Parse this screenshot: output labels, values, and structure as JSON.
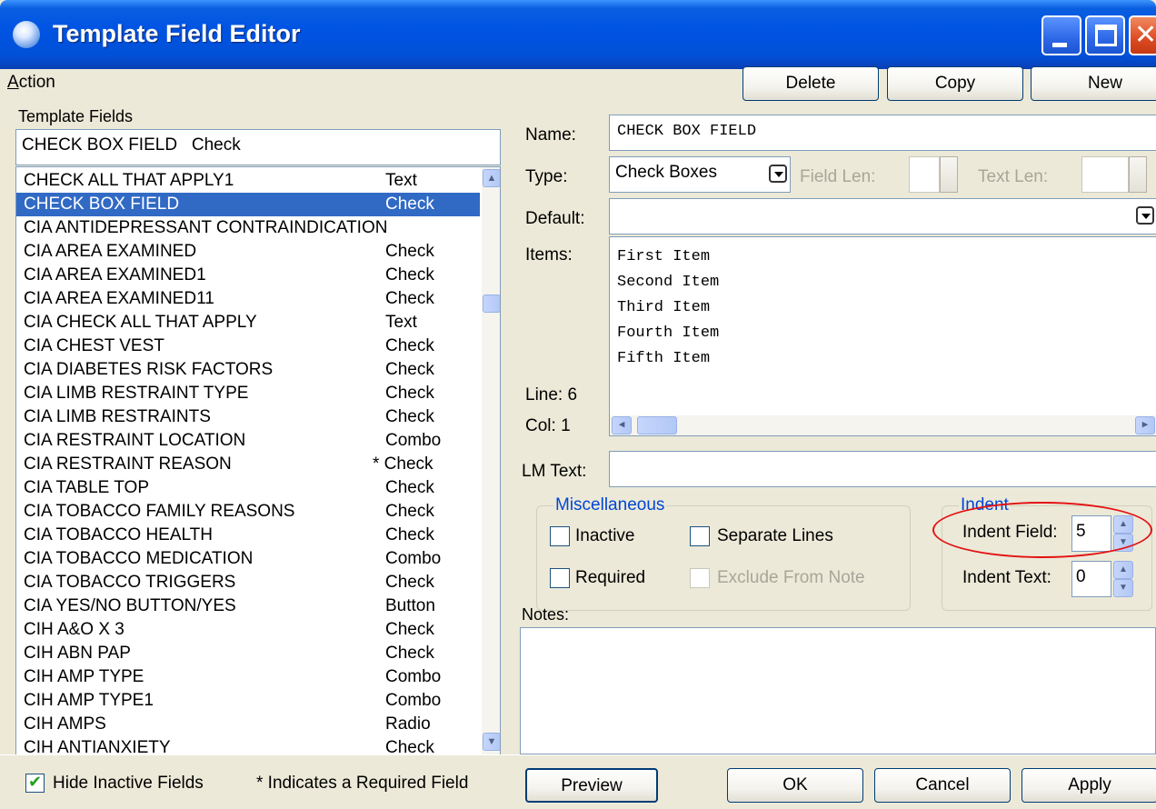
{
  "window": {
    "title": "Template Field Editor"
  },
  "menu": {
    "action_label": "Action"
  },
  "toolbar": {
    "delete_label": "Delete",
    "copy_label": "Copy",
    "new_label": "New"
  },
  "left": {
    "template_fields_label": "Template Fields",
    "selected_display": "CHECK BOX FIELD   Check",
    "fields": [
      {
        "name": "CHECK ALL THAT APPLY1",
        "type": "Text"
      },
      {
        "name": "CHECK BOX FIELD",
        "type": "Check",
        "selected": true
      },
      {
        "name": "CIA ANTIDEPRESSANT CONTRAINDICATION",
        "type": ""
      },
      {
        "name": "CIA AREA EXAMINED",
        "type": "Check"
      },
      {
        "name": "CIA AREA EXAMINED1",
        "type": "Check"
      },
      {
        "name": "CIA AREA EXAMINED11",
        "type": "Check"
      },
      {
        "name": "CIA CHECK ALL THAT APPLY",
        "type": "Text"
      },
      {
        "name": "CIA CHEST VEST",
        "type": "Check"
      },
      {
        "name": "CIA DIABETES RISK FACTORS",
        "type": "Check"
      },
      {
        "name": "CIA LIMB RESTRAINT TYPE",
        "type": "Check"
      },
      {
        "name": "CIA LIMB RESTRAINTS",
        "type": "Check"
      },
      {
        "name": "CIA RESTRAINT LOCATION",
        "type": "Combo"
      },
      {
        "name": "CIA RESTRAINT REASON",
        "type": "* Check"
      },
      {
        "name": "CIA TABLE TOP",
        "type": "Check"
      },
      {
        "name": "CIA TOBACCO FAMILY REASONS",
        "type": "Check"
      },
      {
        "name": "CIA TOBACCO HEALTH",
        "type": "Check"
      },
      {
        "name": "CIA TOBACCO MEDICATION",
        "type": "Combo"
      },
      {
        "name": "CIA TOBACCO TRIGGERS",
        "type": "Check"
      },
      {
        "name": "CIA YES/NO BUTTON/YES",
        "type": "Button"
      },
      {
        "name": "CIH A&O X 3",
        "type": "Check"
      },
      {
        "name": "CIH ABN PAP",
        "type": "Check"
      },
      {
        "name": "CIH AMP TYPE",
        "type": "Combo"
      },
      {
        "name": "CIH AMP TYPE1",
        "type": "Combo"
      },
      {
        "name": "CIH AMPS",
        "type": "Radio"
      },
      {
        "name": "CIH ANTIANXIETY",
        "type": "Check"
      }
    ]
  },
  "right": {
    "name_label": "Name:",
    "name_value": "CHECK BOX FIELD",
    "type_label": "Type:",
    "type_value": "Check Boxes",
    "field_len_label": "Field Len:",
    "text_len_label": "Text Len:",
    "default_label": "Default:",
    "default_value": "",
    "items_label": "Items:",
    "items": [
      "First Item",
      "Second Item",
      "Third Item",
      "Fourth Item",
      "Fifth Item"
    ],
    "line_label": "Line: 6",
    "col_label": "Col: 1",
    "lm_text_label": "LM Text:",
    "lm_text_value": "",
    "misc_title": "Miscellaneous",
    "inactive_label": "Inactive",
    "separate_lines_label": "Separate Lines",
    "required_label": "Required",
    "exclude_from_note_label": "Exclude From Note",
    "indent_title": "Indent",
    "indent_field_label": "Indent Field:",
    "indent_field_value": "5",
    "indent_text_label": "Indent Text:",
    "indent_text_value": "0",
    "notes_label": "Notes:",
    "notes_value": ""
  },
  "bottom": {
    "hide_inactive_label": "Hide Inactive Fields",
    "hide_inactive_checked": true,
    "required_note": "* Indicates a Required Field",
    "preview_label": "Preview",
    "ok_label": "OK",
    "cancel_label": "Cancel",
    "apply_label": "Apply"
  },
  "colors": {
    "titlebar": "#0054e3",
    "selection": "#316ac5",
    "annotation": "#e31212",
    "group_title": "#0046d5"
  }
}
